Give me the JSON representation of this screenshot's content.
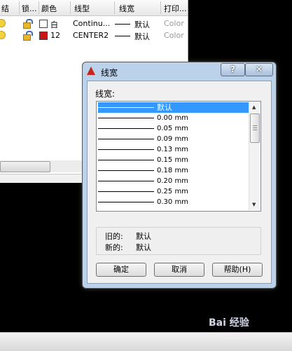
{
  "layer_manager": {
    "headers": [
      "结",
      "锁...",
      "颜色",
      "线型",
      "线宽",
      "打印..."
    ],
    "rows": [
      {
        "color_name": "白",
        "color": "#ffffff",
        "linetype": "Continu...",
        "lineweight": "默认",
        "plot": "Color"
      },
      {
        "color_name": "12",
        "color": "#cc1414",
        "linetype": "CENTER2",
        "lineweight": "默认",
        "plot": "Color"
      }
    ]
  },
  "dialog": {
    "title": "线宽",
    "help_glyph": "?",
    "close_glyph": "✕",
    "list_label": "线宽:",
    "lineweights": [
      {
        "label": "默认",
        "selected": true
      },
      {
        "label": "0.00 mm"
      },
      {
        "label": "0.05 mm"
      },
      {
        "label": "0.09 mm"
      },
      {
        "label": "0.13 mm"
      },
      {
        "label": "0.15 mm"
      },
      {
        "label": "0.18 mm"
      },
      {
        "label": "0.20 mm"
      },
      {
        "label": "0.25 mm"
      },
      {
        "label": "0.30 mm"
      }
    ],
    "old_label": "旧的:",
    "old_value": "默认",
    "new_label": "新的:",
    "new_value": "默认",
    "ok_label": "确定",
    "cancel_label": "取消",
    "help_label": "帮助(H)"
  },
  "watermark": "Bai 经验",
  "colors": {
    "selection": "#3399ff",
    "title_bar": "#bcd2ea"
  }
}
